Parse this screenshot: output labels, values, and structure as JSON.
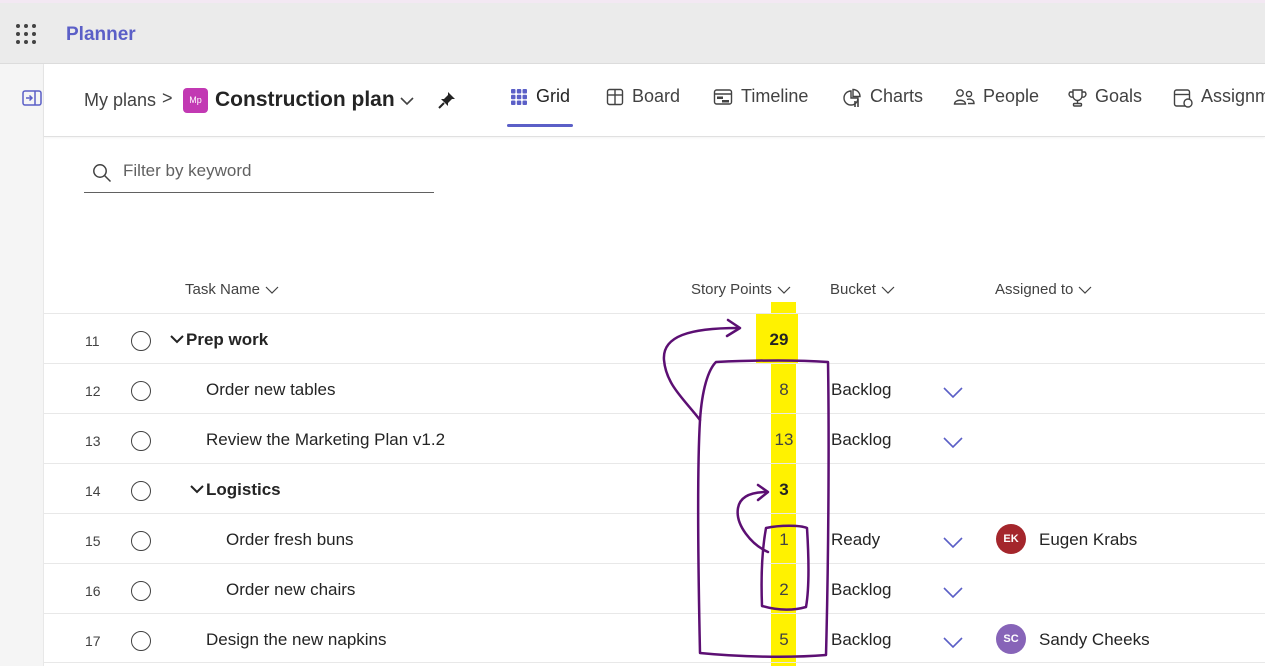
{
  "app": {
    "title": "Planner"
  },
  "breadcrumb": {
    "my_plans": "My plans",
    "separator": ">",
    "plan_icon_text": "Mp",
    "plan_name": "Construction plan"
  },
  "tabs": [
    {
      "label": "Grid",
      "icon": "grid-icon",
      "active": true
    },
    {
      "label": "Board",
      "icon": "board-icon"
    },
    {
      "label": "Timeline",
      "icon": "timeline-icon"
    },
    {
      "label": "Charts",
      "icon": "charts-icon"
    },
    {
      "label": "People",
      "icon": "people-icon"
    },
    {
      "label": "Goals",
      "icon": "trophy-icon"
    },
    {
      "label": "Assignm",
      "icon": "assignments-icon"
    }
  ],
  "filter": {
    "placeholder": "Filter by keyword"
  },
  "columns": {
    "task_name": "Task Name",
    "story_points": "Story Points",
    "bucket": "Bucket",
    "assigned_to": "Assigned to"
  },
  "rows": [
    {
      "num": "11",
      "name": "Prep work",
      "group": true,
      "points": "29",
      "bucket": "",
      "assignee": "",
      "initials": ""
    },
    {
      "num": "12",
      "name": "Order new tables",
      "group": false,
      "points": "8",
      "bucket": "Backlog",
      "assignee": "",
      "initials": ""
    },
    {
      "num": "13",
      "name": "Review the Marketing Plan v1.2",
      "group": false,
      "points": "13",
      "bucket": "Backlog",
      "assignee": "",
      "initials": ""
    },
    {
      "num": "14",
      "name": "Logistics",
      "group": true,
      "points": "3",
      "bucket": "",
      "assignee": "",
      "initials": ""
    },
    {
      "num": "15",
      "name": "Order fresh buns",
      "group": false,
      "points": "1",
      "bucket": "Ready",
      "assignee": "Eugen Krabs",
      "initials": "EK",
      "avatar_color": "#a4262c"
    },
    {
      "num": "16",
      "name": "Order new chairs",
      "group": false,
      "points": "2",
      "bucket": "Backlog",
      "assignee": "",
      "initials": ""
    },
    {
      "num": "17",
      "name": "Design the new napkins",
      "group": false,
      "points": "5",
      "bucket": "Backlog",
      "assignee": "Sandy Cheeks",
      "initials": "SC",
      "avatar_color": "#8764b8"
    }
  ],
  "colors": {
    "accent": "#5b5fc7",
    "highlight": "#fff200",
    "annotation": "#5c0f73",
    "plan_icon": "#c239b3"
  }
}
